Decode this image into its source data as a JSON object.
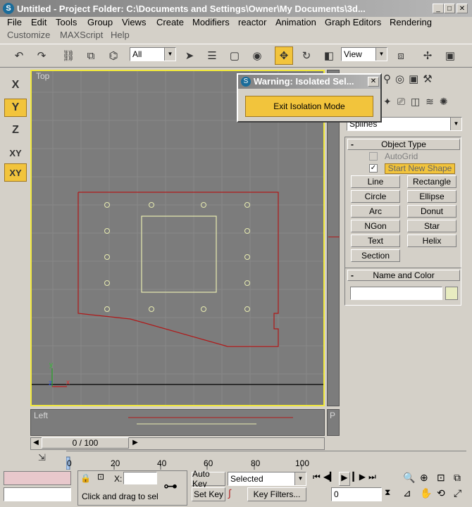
{
  "window": {
    "title": "Untitled     - Project Folder: C:\\Documents and Settings\\Owner\\My Documents\\3d..."
  },
  "menu": {
    "row1": [
      "File",
      "Edit",
      "Tools",
      "Group",
      "Views",
      "Create",
      "Modifiers",
      "reactor",
      "Animation",
      "Graph Editors",
      "Rendering"
    ],
    "row2": [
      "Customize",
      "MAXScript",
      "Help"
    ]
  },
  "toolbar": {
    "selection_filter": "All",
    "coord_system": "View"
  },
  "axis_constraints": [
    "X",
    "Y",
    "Z",
    "XY",
    "XY"
  ],
  "viewports": {
    "top_label": "Top",
    "left_label": "Left",
    "p_label": "P"
  },
  "dialog": {
    "title": "Warning: Isolated Sel...",
    "button": "Exit Isolation Mode"
  },
  "command_panel": {
    "category": "Splines",
    "object_type_title": "Object Type",
    "autogrid_label": "AutoGrid",
    "start_new_shape_label": "Start New Shape",
    "buttons": [
      "Line",
      "Rectangle",
      "Circle",
      "Ellipse",
      "Arc",
      "Donut",
      "NGon",
      "Star",
      "Text",
      "Helix",
      "Section"
    ],
    "name_color_title": "Name and Color",
    "colors": {
      "swatch": "#e8ecc0",
      "accent": "#f2c43c"
    }
  },
  "timeline": {
    "frame_display": "0 / 100",
    "ticks": [
      "0",
      "20",
      "40",
      "60",
      "80",
      "100"
    ]
  },
  "status": {
    "x_label": "X:",
    "prompt": "Click and drag to selec",
    "auto_key": "Auto Key",
    "set_key": "Set Key",
    "key_mode": "Selected",
    "key_filters": "Key Filters...",
    "frame_value": "0"
  }
}
